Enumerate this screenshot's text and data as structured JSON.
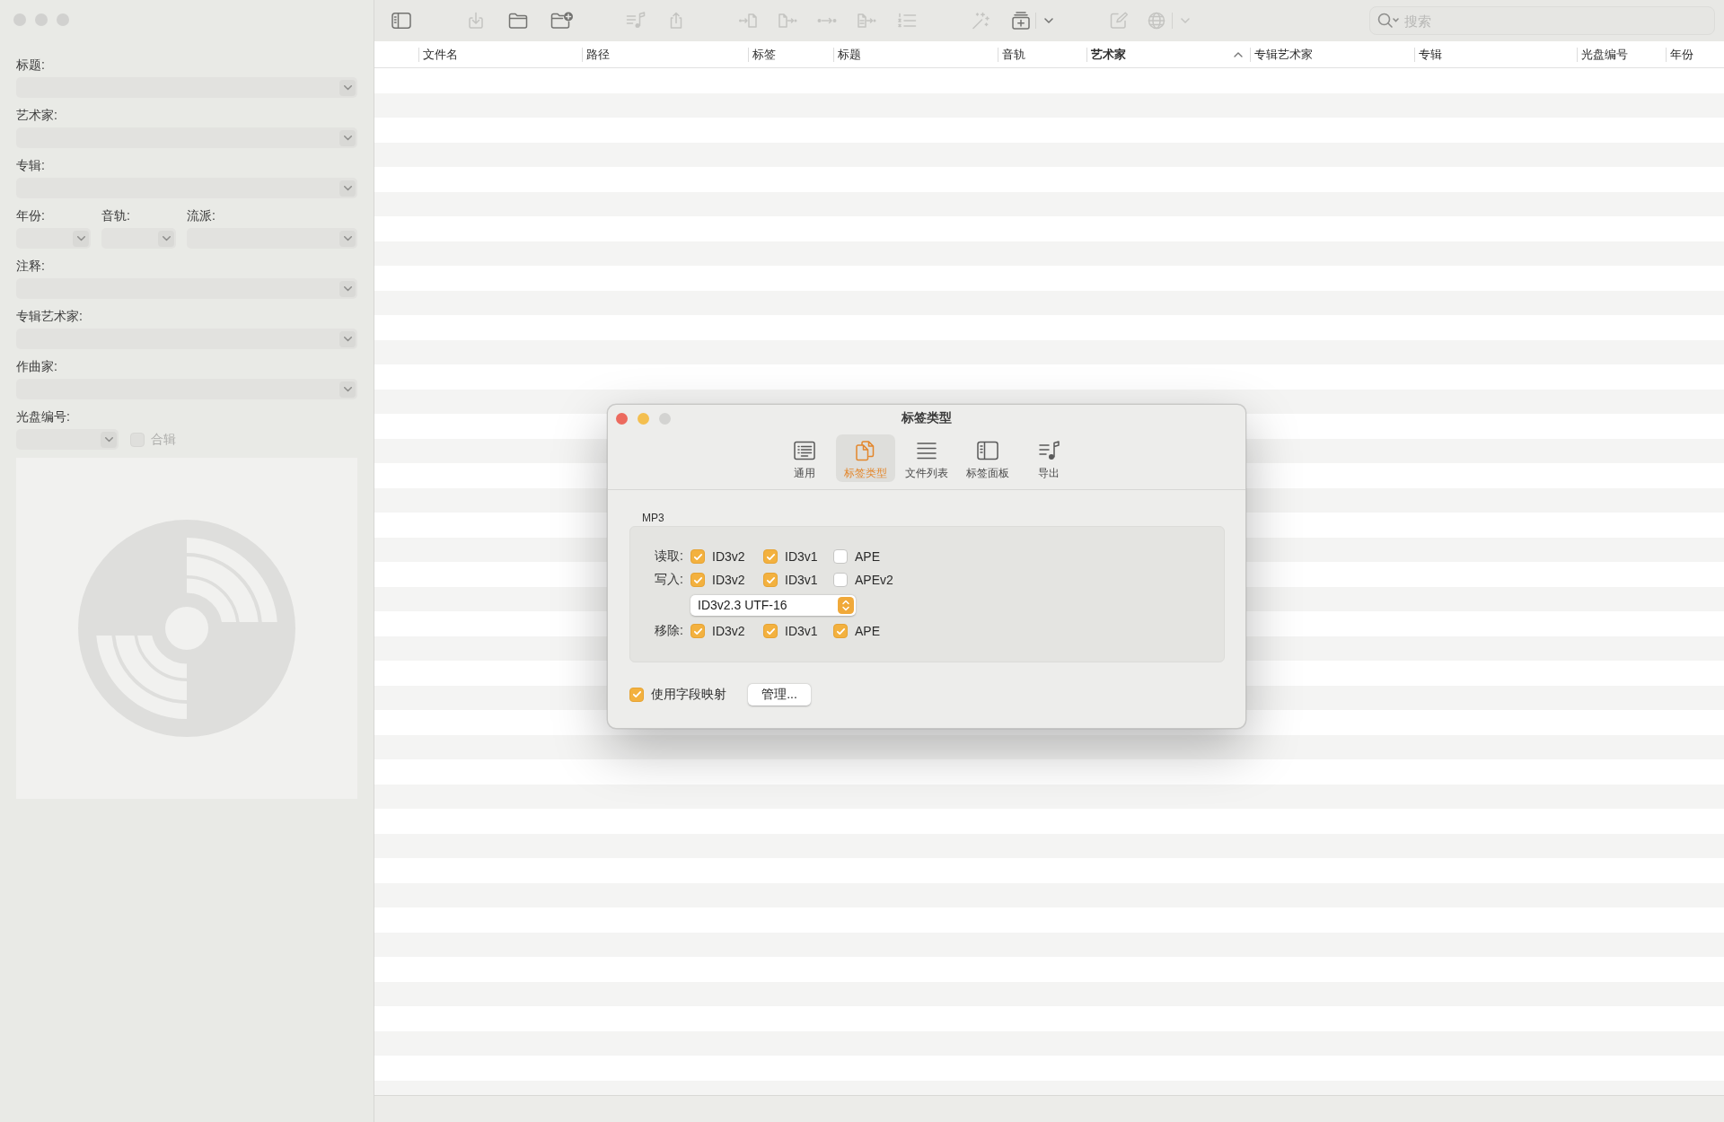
{
  "window": {
    "active": false
  },
  "toolbar": {
    "buttons": [
      {
        "disabled": false
      },
      {
        "disabled": true
      },
      {
        "disabled": false
      },
      {
        "disabled": false
      },
      {
        "disabled": true
      },
      {
        "disabled": true
      },
      {
        "disabled": true
      },
      {
        "disabled": true
      },
      {
        "disabled": true
      },
      {
        "disabled": true
      },
      {
        "disabled": true
      },
      {
        "disabled": true
      },
      {
        "disabled": false
      },
      {
        "disabled": false
      },
      {
        "disabled": true
      },
      {
        "disabled": true
      },
      {
        "disabled": true
      }
    ],
    "search": {
      "placeholder": "搜索"
    }
  },
  "sidebar": {
    "rows": [
      {
        "fields": [
          {
            "label": "标题:"
          }
        ]
      },
      {
        "fields": [
          {
            "label": "艺术家:"
          }
        ]
      },
      {
        "fields": [
          {
            "label": "专辑:"
          }
        ]
      },
      {
        "fields": [
          {
            "label": "年份:"
          },
          {
            "label": "音轨:"
          },
          {
            "label": "流派:"
          }
        ]
      },
      {
        "fields": [
          {
            "label": "注释:"
          }
        ]
      },
      {
        "fields": [
          {
            "label": "专辑艺术家:"
          }
        ]
      },
      {
        "fields": [
          {
            "label": "作曲家:"
          }
        ]
      },
      {
        "fields": [
          {
            "label": "光盘编号:"
          }
        ],
        "compilation": {
          "label": "合辑",
          "checked": false,
          "disabled": true
        }
      }
    ]
  },
  "table": {
    "columns": [
      {
        "label": "文件名",
        "sorted": false
      },
      {
        "label": "路径",
        "sorted": false
      },
      {
        "label": "标签",
        "sorted": false
      },
      {
        "label": "标题",
        "sorted": false
      },
      {
        "label": "音轨",
        "sorted": false
      },
      {
        "label": "艺术家",
        "sorted": true
      },
      {
        "label": "专辑艺术家",
        "sorted": false
      },
      {
        "label": "专辑",
        "sorted": false
      },
      {
        "label": "光盘编号",
        "sorted": false
      },
      {
        "label": "年份",
        "sorted": false
      }
    ]
  },
  "dialog": {
    "active": true,
    "title": "标签类型",
    "tabs": [
      {
        "label": "通用",
        "selected": false
      },
      {
        "label": "标签类型",
        "selected": true
      },
      {
        "label": "文件列表",
        "selected": false
      },
      {
        "label": "标签面板",
        "selected": false
      },
      {
        "label": "导出",
        "selected": false
      }
    ],
    "section": {
      "title": "MP3",
      "rows": [
        {
          "kind": "checks",
          "label": "读取:",
          "options": [
            {
              "label": "ID3v2",
              "checked": true
            },
            {
              "label": "ID3v1",
              "checked": true
            },
            {
              "label": "APE",
              "checked": false
            }
          ]
        },
        {
          "kind": "checks",
          "label": "写入:",
          "options": [
            {
              "label": "ID3v2",
              "checked": true
            },
            {
              "label": "ID3v1",
              "checked": true
            },
            {
              "label": "APEv2",
              "checked": false
            }
          ]
        },
        {
          "kind": "popup",
          "value": "ID3v2.3 UTF-16"
        },
        {
          "kind": "checks",
          "label": "移除:",
          "options": [
            {
              "label": "ID3v2",
              "checked": true
            },
            {
              "label": "ID3v1",
              "checked": true
            },
            {
              "label": "APE",
              "checked": true
            }
          ]
        }
      ]
    },
    "field_mapping": {
      "label": "使用字段映射",
      "checked": true
    },
    "manage_button": "管理..."
  }
}
